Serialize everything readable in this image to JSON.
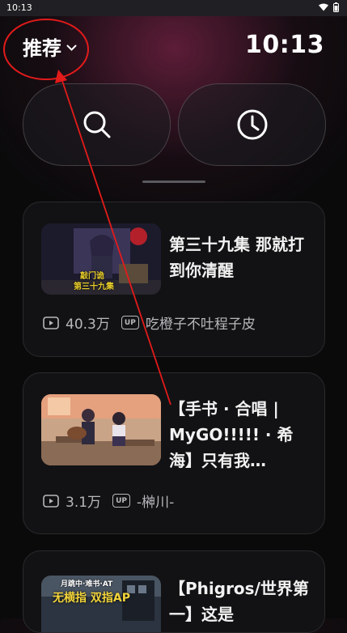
{
  "status_bar": {
    "time": "10:13",
    "icons": [
      "wifi-icon",
      "battery-icon"
    ]
  },
  "header": {
    "category": "推荐",
    "clock": "10:13"
  },
  "actions": [
    {
      "name": "search",
      "icon": "search-icon"
    },
    {
      "name": "history",
      "icon": "clock-icon"
    }
  ],
  "videos": [
    {
      "title": "第三十九集 那就打到你清醒",
      "views": "40.3万",
      "uploader": "吃橙子不吐程子皮",
      "thumb_text": [
        "敲门诡",
        "第三十九集"
      ]
    },
    {
      "title": "【手书 · 合唱 | MyGO!!!!! · 希海】只有我…",
      "views": "3.1万",
      "uploader": "-榊川-"
    },
    {
      "title": "【Phigros/世界第一】这是",
      "thumb_text": [
        "月跳中·难书·AT",
        "无横指 双指AP"
      ]
    }
  ],
  "colors": {
    "annotation": "#e31b1b",
    "accent_bg": "#7a2346"
  }
}
